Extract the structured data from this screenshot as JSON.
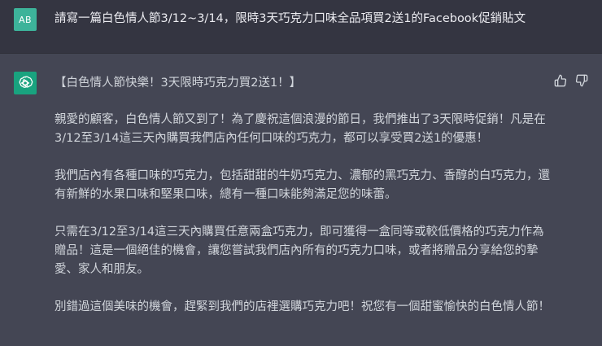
{
  "user": {
    "avatar_initials": "AB",
    "message": "請寫一篇白色情人節3/12~3/14，限時3天巧克力口味全品項買2送1的Facebook促銷貼文"
  },
  "assistant": {
    "avatar_icon": "openai-logo-icon",
    "paragraphs": [
      "【白色情人節快樂！3天限時巧克力買2送1！】",
      "親愛的顧客，白色情人節又到了！為了慶祝這個浪漫的節日，我們推出了3天限時促銷！凡是在3/12至3/14這三天內購買我們店內任何口味的巧克力，都可以享受買2送1的優惠！",
      "我們店內有各種口味的巧克力，包括甜甜的牛奶巧克力、濃郁的黑巧克力、香醇的白巧克力，還有新鮮的水果口味和堅果口味，總有一種口味能夠滿足您的味蕾。",
      "只需在3/12至3/14這三天內購買任意兩盒巧克力，即可獲得一盒同等或較低價格的巧克力作為贈品！這是一個絕佳的機會，讓您嘗試我們店內所有的巧克力口味，或者將贈品分享給您的摯愛、家人和朋友。",
      "別錯過這個美味的機會，趕緊到我們的店裡選購巧克力吧！祝您有一個甜蜜愉快的白色情人節！"
    ],
    "feedback_icons": [
      "thumbs-up-icon",
      "thumbs-down-icon"
    ]
  },
  "colors": {
    "user_bg": "#343541",
    "assistant_bg": "#444654",
    "user_avatar": "#3db39a",
    "bot_avatar": "#19a37f",
    "text": "#d1d5db"
  }
}
